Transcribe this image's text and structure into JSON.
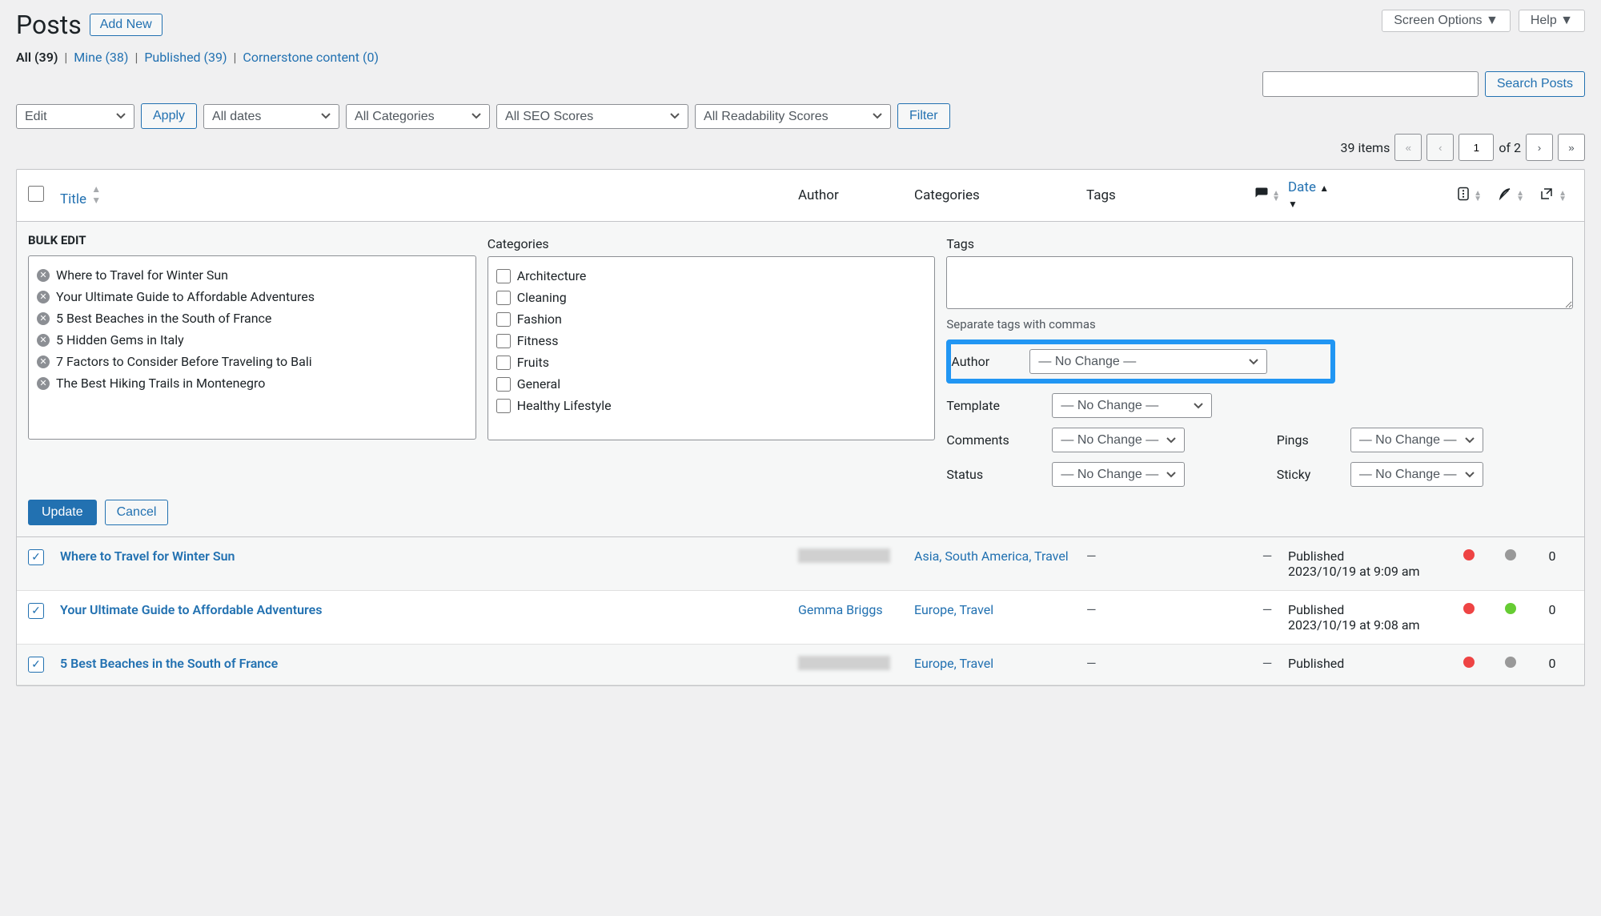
{
  "header": {
    "title": "Posts",
    "add_new": "Add New"
  },
  "topbuttons": {
    "screen_options": "Screen Options ▼",
    "help": "Help ▼"
  },
  "subsubsub": {
    "all_label": "All",
    "all_count": "(39)",
    "mine_label": "Mine",
    "mine_count": "(38)",
    "published_label": "Published",
    "published_count": "(39)",
    "cornerstone_label": "Cornerstone content",
    "cornerstone_count": "(0)"
  },
  "filters": {
    "bulk": "Edit",
    "apply": "Apply",
    "dates": "All dates",
    "categories": "All Categories",
    "seo": "All SEO Scores",
    "readability": "All Readability Scores",
    "filter": "Filter"
  },
  "search": {
    "button": "Search Posts"
  },
  "pagination": {
    "items_text": "39 items",
    "current": "1",
    "of_text": "of 2"
  },
  "columns": {
    "title": "Title",
    "author": "Author",
    "categories": "Categories",
    "tags": "Tags",
    "date": "Date"
  },
  "bulkedit": {
    "heading": "BULK EDIT",
    "cat_label": "Categories",
    "tags_label": "Tags",
    "tags_help": "Separate tags with commas",
    "posts": [
      "Where to Travel for Winter Sun",
      "Your Ultimate Guide to Affordable Adventures",
      "5 Best Beaches in the South of France",
      "5 Hidden Gems in Italy",
      "7 Factors to Consider Before Traveling to Bali",
      "The Best Hiking Trails in Montenegro"
    ],
    "categories": [
      "Architecture",
      "Cleaning",
      "Fashion",
      "Fitness",
      "Fruits",
      "General",
      "Healthy Lifestyle"
    ],
    "author_label": "Author",
    "template_label": "Template",
    "comments_label": "Comments",
    "status_label": "Status",
    "pings_label": "Pings",
    "sticky_label": "Sticky",
    "no_change": "— No Change —",
    "update": "Update",
    "cancel": "Cancel"
  },
  "rows": [
    {
      "title": "Where to Travel for Winter Sun",
      "author_redacted": true,
      "categories": "Asia, South America, Travel",
      "tags": "—",
      "comments": "—",
      "date_status": "Published",
      "date_text": "2023/10/19 at 9:09 am",
      "seo": "red",
      "read": "gray",
      "links": "0"
    },
    {
      "title": "Your Ultimate Guide to Affordable Adventures",
      "author": "Gemma Briggs",
      "categories": "Europe, Travel",
      "tags": "—",
      "comments": "—",
      "date_status": "Published",
      "date_text": "2023/10/19 at 9:08 am",
      "seo": "red",
      "read": "green",
      "links": "0"
    },
    {
      "title": "5 Best Beaches in the South of France",
      "author_redacted": true,
      "categories": "Europe, Travel",
      "tags": "—",
      "comments": "—",
      "date_status": "Published",
      "date_text": "",
      "seo": "red",
      "read": "gray",
      "links": "0"
    }
  ]
}
